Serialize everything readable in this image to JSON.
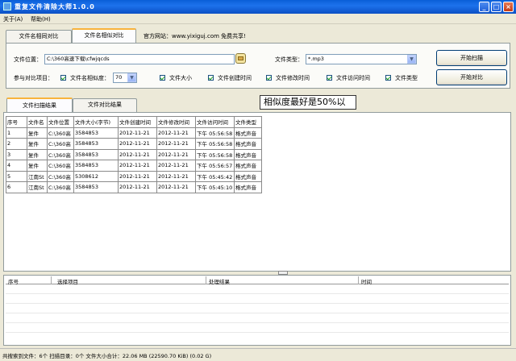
{
  "window": {
    "title": "重复文件清除大师1.0.0"
  },
  "menu": [
    "关于(A)",
    "帮助(H)"
  ],
  "tabs": {
    "content_compare": "文件名相同对比",
    "name_similar": "文件名相似对比"
  },
  "website": "官方网站：www.yixiguj.com 免费共享!",
  "form": {
    "location_label": "文件位置：",
    "location_value": "C:\\360高速下载\\cfwjqcds",
    "type_label": "文件类型：",
    "type_value": "*.mp3",
    "params_label": "参与对比项目：",
    "similar_label": "文件名相似度：",
    "similar_value": "70",
    "checks": [
      "文件大小",
      "文件创建时间",
      "文件修改时间",
      "文件访问时间",
      "文件类型"
    ]
  },
  "buttons": {
    "scan": "开始扫描",
    "compare": "开始对比"
  },
  "result_tabs": {
    "scan": "文件扫描结果",
    "compare": "文件对比结果"
  },
  "callout": "相似度最好是50%以",
  "table": {
    "headers": [
      "序号",
      "文件名",
      "文件位置",
      "文件大小(字节)",
      "文件创建时间",
      "文件修改时间",
      "文件访问时间",
      "文件类型"
    ],
    "rows": [
      [
        "1",
        "复件",
        "C:\\360高",
        "3584853",
        "2012-11-21",
        "2012-11-21",
        "下午 05:56:58",
        "格式声音"
      ],
      [
        "2",
        "复件",
        "C:\\360高",
        "3584853",
        "2012-11-21",
        "2012-11-21",
        "下午 05:56:58",
        "格式声音"
      ],
      [
        "3",
        "复件",
        "C:\\360高",
        "3584853",
        "2012-11-21",
        "2012-11-21",
        "下午 05:56:58",
        "格式声音"
      ],
      [
        "4",
        "复件",
        "C:\\360高",
        "3584853",
        "2012-11-21",
        "2012-11-21",
        "下午 05:56:57",
        "格式声音"
      ],
      [
        "5",
        "江南St",
        "C:\\360高",
        "5308612",
        "2012-11-21",
        "2012-11-21",
        "下午 05:45:42",
        "格式声音"
      ],
      [
        "6",
        "江南St",
        "C:\\360高",
        "3584853",
        "2012-11-21",
        "2012-11-21",
        "下午 05:45:10",
        "格式声音"
      ]
    ]
  },
  "log": {
    "headers": [
      "序号",
      "选择项目",
      "处理结果",
      "时间"
    ]
  },
  "status": "共搜索到文件：6个   扫描目录：0个   文件大小合计：22.06 MB (22590.70 KiB) (0.02 G)"
}
